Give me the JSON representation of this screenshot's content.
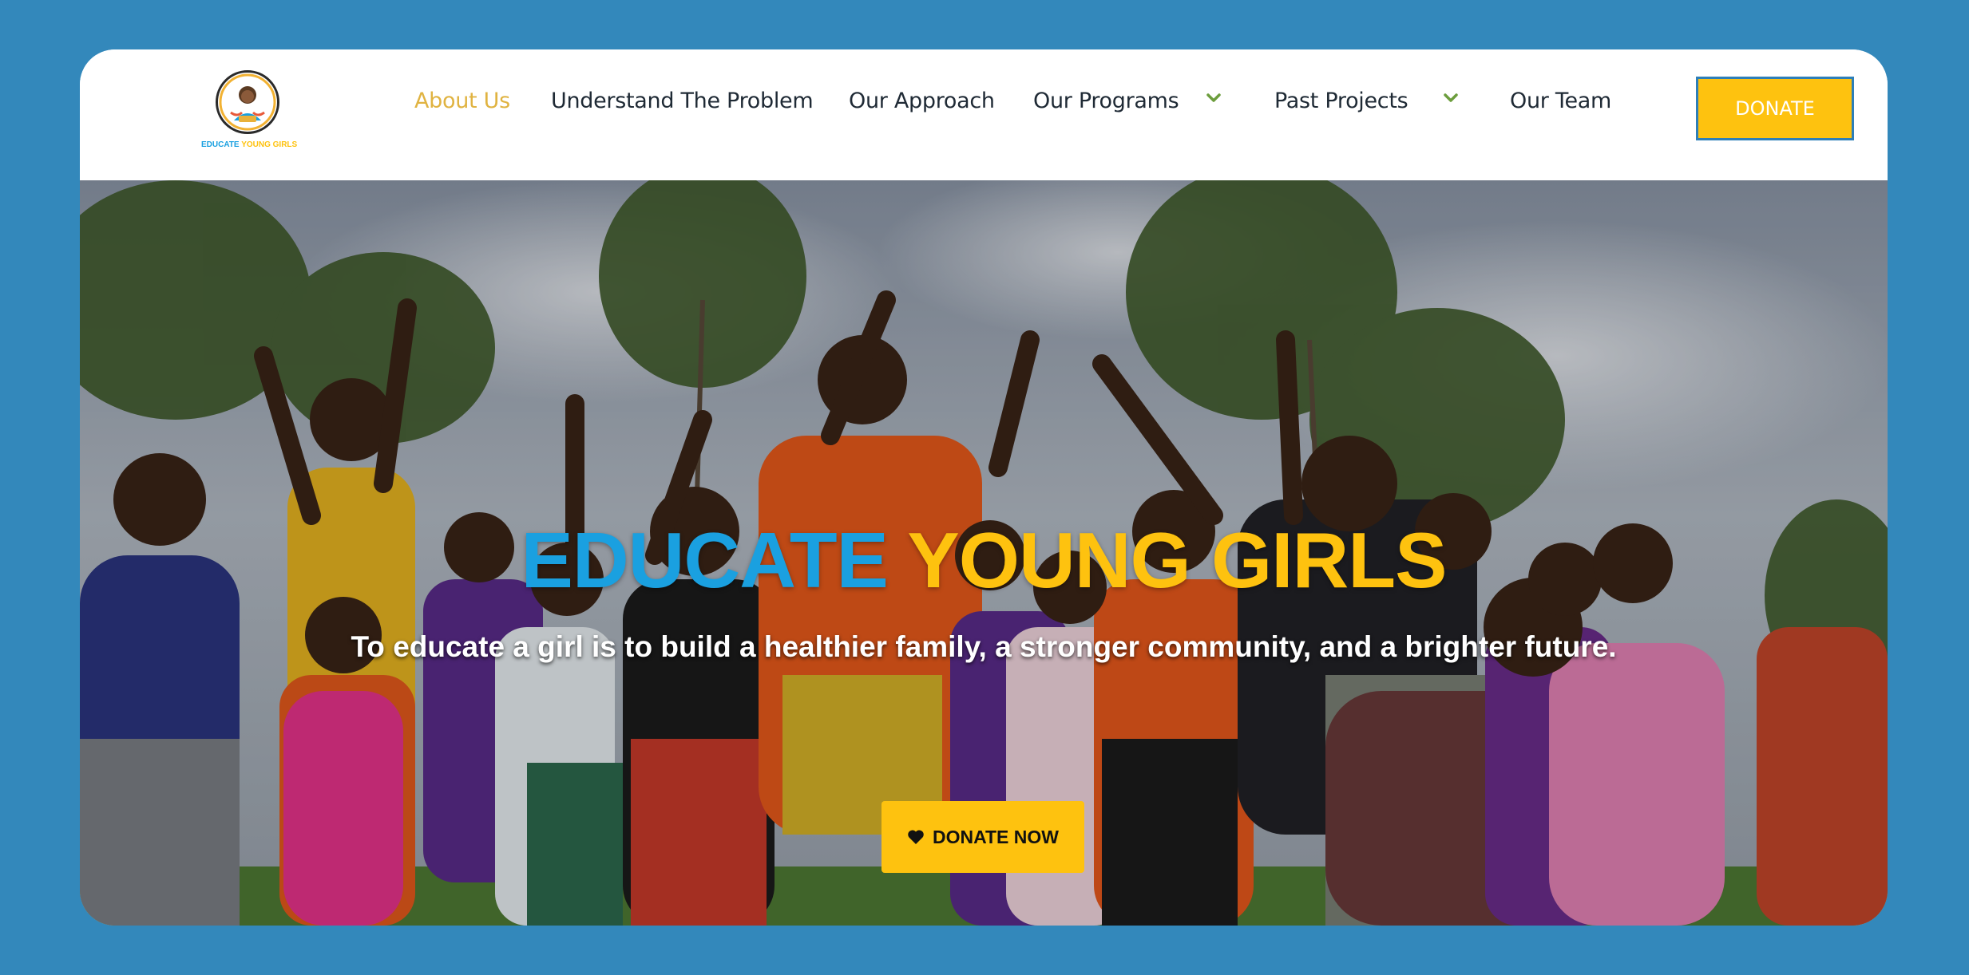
{
  "brand": {
    "logo_text_part1": "EDUCATE",
    "logo_text_part2": "YOUNG GIRLS",
    "blue": "#1aa0e0",
    "yellow": "#fec20f"
  },
  "nav": {
    "items": [
      {
        "label": "About Us",
        "active": true
      },
      {
        "label": "Understand The Problem"
      },
      {
        "label": "Our Approach"
      },
      {
        "label": "Our Programs",
        "has_dropdown": true
      },
      {
        "label": "Past Projects",
        "has_dropdown": true
      },
      {
        "label": "Our Team"
      }
    ],
    "active_color": "#e0b341",
    "donate_label": "DONATE"
  },
  "hero": {
    "title_part1": "EDUCATE",
    "title_part2": "YOUNG GIRLS",
    "subtitle": "To educate a girl is to build a healthier family, a stronger community, and a brighter future.",
    "cta_label": "DONATE NOW",
    "cta_icon": "heart-icon"
  }
}
